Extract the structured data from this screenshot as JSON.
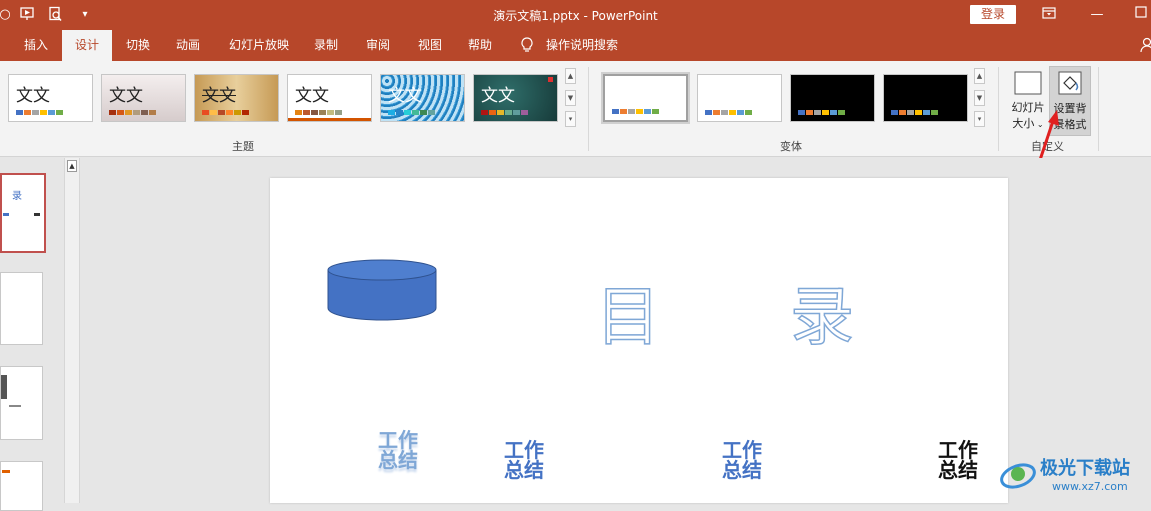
{
  "window": {
    "title": "演示文稿1.pptx  -  PowerPoint",
    "login_label": "登录"
  },
  "quick_access": {
    "icons": [
      "autosave-icon",
      "slideshow-from-start-icon",
      "print-preview-icon",
      "customize-qat-icon"
    ]
  },
  "tabs": [
    {
      "label": "插入",
      "active": false
    },
    {
      "label": "设计",
      "active": true
    },
    {
      "label": "切换",
      "active": false
    },
    {
      "label": "动画",
      "active": false
    },
    {
      "label": "幻灯片放映",
      "active": false
    },
    {
      "label": "录制",
      "active": false
    },
    {
      "label": "审阅",
      "active": false
    },
    {
      "label": "视图",
      "active": false
    },
    {
      "label": "帮助",
      "active": false
    }
  ],
  "tell_me": {
    "label": "操作说明搜索"
  },
  "ribbon": {
    "themes_label": "主题",
    "variants_label": "变体",
    "customize_label": "自定义",
    "theme_thumb_text": "文文",
    "slide_size_label_1": "幻灯片",
    "slide_size_label_2": "大小",
    "format_bg_label_1": "设置背",
    "format_bg_label_2": "景格式"
  },
  "slide": {
    "title_char_1": "目",
    "title_char_2": "录",
    "wordart_line_1": "工作",
    "wordart_line_2": "总结"
  },
  "thumbnail_1": {
    "title": "录"
  },
  "watermark": {
    "brand": "极光下载站",
    "url": "www.xz7.com"
  },
  "colors": {
    "accent": "#b7472a",
    "shape_fill": "#4472c4",
    "annotation_arrow": "#e02020"
  }
}
